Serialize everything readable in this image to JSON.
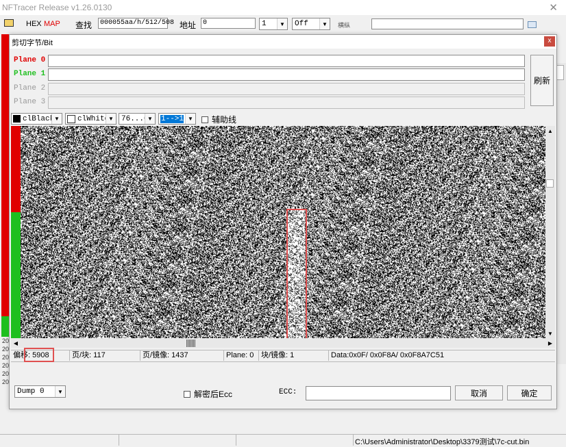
{
  "app": {
    "title": "NFTracer Release v1.26.0130"
  },
  "toolbar": {
    "hex_label": "HEX",
    "map_label": "MAP",
    "search_label": "查找",
    "search_value": "000055aa/h/512/508",
    "address_label": "地址",
    "address_value": "0",
    "count_value": "1",
    "off_value": "Off",
    "mode_label": "横纵",
    "colors": {
      "map": "#e00000"
    }
  },
  "dialog": {
    "title": "剪切字节/Bit",
    "close_label": "x",
    "planes": [
      {
        "label": "Plane 0",
        "color": "#e00000",
        "value": ""
      },
      {
        "label": "Plane 1",
        "color": "#1fbf1f",
        "value": ""
      },
      {
        "label": "Plane 2",
        "color": "#999999",
        "value": ""
      },
      {
        "label": "Plane 3",
        "color": "#999999",
        "value": ""
      }
    ],
    "refresh_label": "刷新",
    "fg_color": "clBlack",
    "bg_color": "clWhite",
    "bit_order": "76...0",
    "direction": "1-->1",
    "aux_line_label": "辅助线",
    "status": {
      "offset_label": "偏移",
      "offset_value": "5908",
      "page_block": "页/块: 117",
      "page_mirror": "页/镜像: 1437",
      "plane": "Plane: 0",
      "block_mirror": "块/镜像: 1",
      "data": "Data:0x0F/ 0x0F8A/ 0x0F8A7C51"
    },
    "dump_value": "Dump 0",
    "decrypt_ecc_label": "解密后Ecc",
    "ecc_label": "ECC:",
    "ecc_value": "",
    "cancel_label": "取消",
    "ok_label": "确定"
  },
  "background": {
    "row_labels": [
      "20",
      "20",
      "20",
      "20",
      "20",
      "20"
    ]
  },
  "statusbar": {
    "path": "C:\\Users\\Administrator\\Desktop\\3379测试\\7c-cut.bin"
  },
  "highlight_color": "#e05050"
}
